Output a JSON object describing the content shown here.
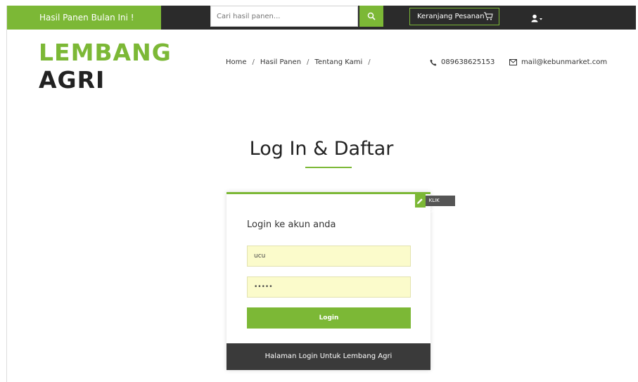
{
  "topbar": {
    "promo_label": "Hasil Panen Bulan Ini !",
    "search_placeholder": "Cari hasil panen...",
    "search_icon": "search-icon",
    "cart_label": "Keranjang Pesanan",
    "cart_icon": "cart-icon",
    "user_icon": "user-icon"
  },
  "header": {
    "logo_line1": "LEMBANG",
    "logo_line2": "AGRI",
    "nav": [
      {
        "label": "Home"
      },
      {
        "label": "Hasil Panen"
      },
      {
        "label": "Tentang Kami"
      }
    ],
    "nav_separator": "/",
    "phone": "089638625153",
    "email": "mail@kebunmarket.com"
  },
  "page": {
    "title": "Log In & Daftar"
  },
  "login": {
    "register_toggle": "KLIK DAFTAR",
    "heading": "Login ke akun anda",
    "username_value": "ucu",
    "password_value": "•••••",
    "submit_label": "Login",
    "footer_text": "Halaman Login Untuk Lembang Agri"
  },
  "colors": {
    "accent": "#7cb836",
    "dark": "#2b2b2b",
    "input_bg": "#fbfbcb"
  }
}
